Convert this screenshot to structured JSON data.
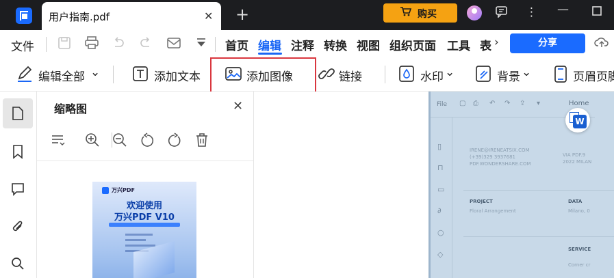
{
  "tab": {
    "title": "用户指南.pdf",
    "close": "✕",
    "new_tab": "+"
  },
  "titlebar": {
    "buy_label": "购买",
    "buy_icon": "cart-icon",
    "cart_glyph": "🛒",
    "feedback_glyph": "☐",
    "more_glyph": "⋮",
    "minimize_glyph": "—",
    "maximize_glyph": "☐"
  },
  "menubar": {
    "file": "文件",
    "nav": [
      "首页",
      "编辑",
      "注释",
      "转换",
      "视图",
      "组织页面",
      "工具",
      "表"
    ],
    "active_nav": "编辑",
    "more_arrow": "›",
    "share": "分享"
  },
  "toolbar": {
    "edit_all": "编辑全部",
    "add_text": "添加文本",
    "add_image": "添加图像",
    "link": "链接",
    "watermark": "水印",
    "background": "背景",
    "header_footer": "页眉页脚",
    "chevron": "⌄"
  },
  "panel": {
    "title": "缩略图",
    "close": "✕"
  },
  "thumbnail": {
    "brand": "万兴PDF",
    "heading1": "欢迎使用",
    "heading2": "万兴PDF V10"
  },
  "document": {
    "file": "File",
    "home": "Home",
    "contact": [
      "IRENE@IRENEATSIX.COM",
      "(+39)329 3937681",
      "PDF.WONDERSHARE.COM"
    ],
    "address": [
      "VIA PDF.9",
      "2022 MILAN"
    ],
    "project_label": "PROJECT",
    "project_value": "Floral Arrangement",
    "data_label": "DATA",
    "data_value": "Milano, 0",
    "service_label": "SERVICE",
    "service_value": "Corner cr"
  },
  "colors": {
    "accent": "#1a66f5",
    "buy": "#f5a212",
    "highlight_box": "#d9363e",
    "titlebar": "#1c1d20"
  }
}
